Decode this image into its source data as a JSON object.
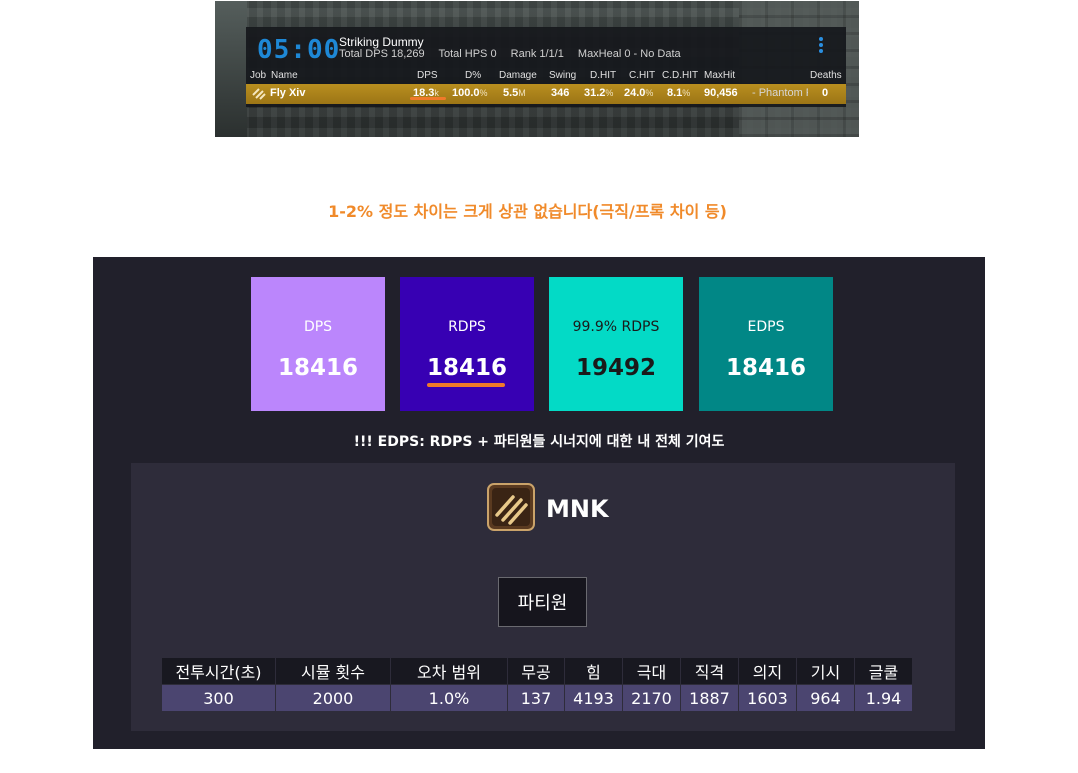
{
  "act": {
    "timer": "05:00",
    "encounter_name": "Striking Dummy",
    "total_dps": "Total DPS 18,269",
    "total_hps": "Total HPS 0",
    "rank": "Rank 1/1/1",
    "max_heal": "MaxHeal 0 - No Data",
    "headers": [
      "Job",
      "Name",
      "DPS",
      "D%",
      "Damage",
      "Swing",
      "D.HIT",
      "C.HIT",
      "C.D.HIT",
      "MaxHit",
      "Deaths"
    ],
    "row": {
      "name": "Fly Xiv",
      "dps": "18.3",
      "dps_unit": "k",
      "dpct": "100.0",
      "dpct_unit": "%",
      "damage": "5.5",
      "damage_unit": "M",
      "swing": "346",
      "dhit": "31.2",
      "dhit_unit": "%",
      "chit": "24.0",
      "chit_unit": "%",
      "cdhit": "8.1",
      "cdhit_unit": "%",
      "maxhit": "90,456",
      "maxhit_skill": "- Phantom F",
      "deaths": "0"
    },
    "colors": {
      "timer": "#1e88d6",
      "row_bg": "#b98f1f"
    }
  },
  "note": "1-2% 정도 차이는 크게 상관 없습니다(극직/프록 차이 등)",
  "stat_boxes": [
    {
      "label": "DPS",
      "value": "18416",
      "color": "#bb86fc"
    },
    {
      "label": "RDPS",
      "value": "18416",
      "color": "#3700b3"
    },
    {
      "label": "99.9% RDPS",
      "value": "19492",
      "color": "#03dac6"
    },
    {
      "label": "EDPS",
      "value": "18416",
      "color": "#018786"
    }
  ],
  "edps_note": "!!! EDPS: RDPS + 파티원들 시너지에 대한 내 전체 기여도",
  "job": {
    "name": "MNK",
    "icon": "mnk-job-icon"
  },
  "party_button": "파티원",
  "table": {
    "headers": [
      "전투시간(초)",
      "시뮬 횟수",
      "오차 범위",
      "무공",
      "힘",
      "극대",
      "직격",
      "의지",
      "기시",
      "글쿨"
    ],
    "values": [
      "300",
      "2000",
      "1.0%",
      "137",
      "4193",
      "2170",
      "1887",
      "1603",
      "964",
      "1.94"
    ]
  },
  "accent": "#f07a2a"
}
